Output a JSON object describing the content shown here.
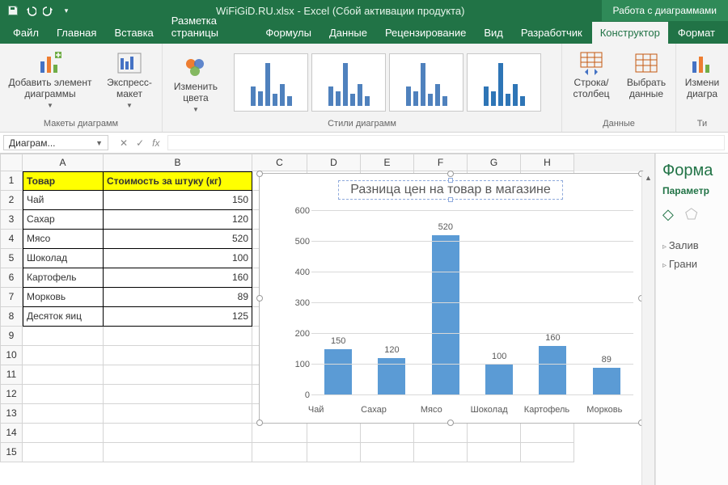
{
  "titlebar": {
    "filename": "WiFiGiD.RU.xlsx",
    "appname": "Excel",
    "suffix": "(Сбой активации продукта)",
    "contextual": "Работа с диаграммами"
  },
  "tabs": {
    "file": "Файл",
    "home": "Главная",
    "insert": "Вставка",
    "layout": "Разметка страницы",
    "formulas": "Формулы",
    "data": "Данные",
    "review": "Рецензирование",
    "view": "Вид",
    "developer": "Разработчик",
    "design": "Конструктор",
    "format": "Формат"
  },
  "ribbon": {
    "add_element": "Добавить элемент диаграммы",
    "quick_layout": "Экспресс-макет",
    "group_layouts": "Макеты диаграмм",
    "change_colors": "Изменить цвета",
    "group_styles": "Стили диаграмм",
    "switch_rowcol": "Строка/ столбец",
    "select_data": "Выбрать данные",
    "group_data": "Данные",
    "change_type": "Измени диагра",
    "group_type": "Ти"
  },
  "namebox": "Диаграм...",
  "fx": {
    "cancel": "✕",
    "enter": "✓",
    "fx": "fx"
  },
  "cols": [
    "A",
    "B",
    "C",
    "D",
    "E",
    "F",
    "G",
    "H"
  ],
  "colw": {
    "A": 100,
    "B": 184,
    "C": 68,
    "D": 66,
    "E": 66,
    "F": 66,
    "G": 66,
    "H": 66
  },
  "table": {
    "headers": {
      "A": "Товар",
      "B": "Стоимость за штуку (кг)"
    },
    "rows": [
      {
        "a": "Чай",
        "b": "150"
      },
      {
        "a": "Сахар",
        "b": "120"
      },
      {
        "a": "Мясо",
        "b": "520"
      },
      {
        "a": "Шоколад",
        "b": "100"
      },
      {
        "a": "Картофель",
        "b": "160"
      },
      {
        "a": "Морковь",
        "b": "89"
      },
      {
        "a": "Десяток яиц",
        "b": "125"
      }
    ]
  },
  "row_count": 15,
  "chart_data": {
    "type": "bar",
    "title": "Разница цен на товар в магазине",
    "categories": [
      "Чай",
      "Сахар",
      "Мясо",
      "Шоколад",
      "Картофель",
      "Морковь"
    ],
    "values": [
      150,
      120,
      520,
      100,
      160,
      89
    ],
    "ylim": [
      0,
      600
    ],
    "yticks": [
      0,
      100,
      200,
      300,
      400,
      500,
      600
    ],
    "xlabel": "",
    "ylabel": ""
  },
  "sidepane": {
    "title": "Форма",
    "subtitle": "Параметр",
    "section_fill": "Залив",
    "section_border": "Грани"
  }
}
